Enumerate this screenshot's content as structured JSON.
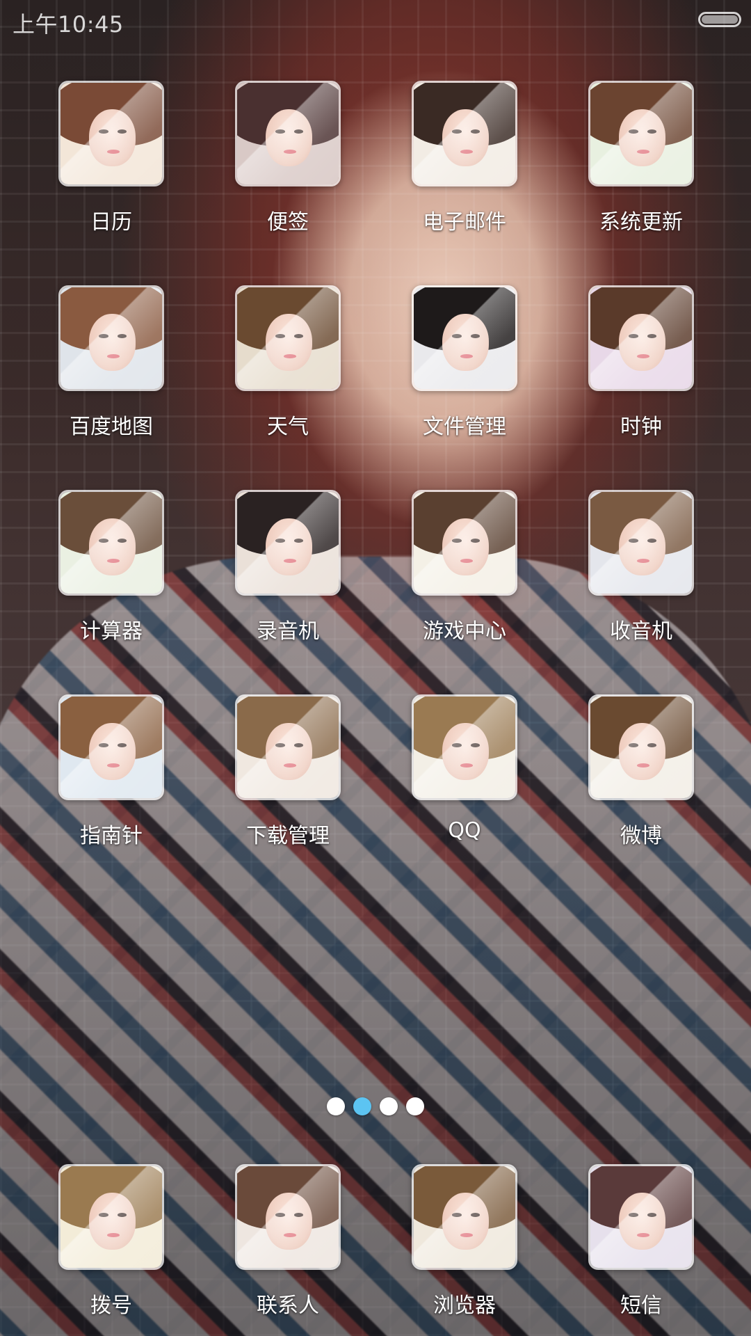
{
  "status_bar": {
    "time": "上午10:45",
    "battery_icon": "battery-icon"
  },
  "apps": [
    {
      "label": "日历",
      "icon": "calendar-icon"
    },
    {
      "label": "便签",
      "icon": "notes-icon"
    },
    {
      "label": "电子邮件",
      "icon": "email-icon"
    },
    {
      "label": "系统更新",
      "icon": "system-update-icon"
    },
    {
      "label": "百度地图",
      "icon": "baidu-map-icon"
    },
    {
      "label": "天气",
      "icon": "weather-icon"
    },
    {
      "label": "文件管理",
      "icon": "file-manager-icon"
    },
    {
      "label": "时钟",
      "icon": "clock-icon"
    },
    {
      "label": "计算器",
      "icon": "calculator-icon"
    },
    {
      "label": "录音机",
      "icon": "recorder-icon"
    },
    {
      "label": "游戏中心",
      "icon": "game-center-icon"
    },
    {
      "label": "收音机",
      "icon": "radio-icon"
    },
    {
      "label": "指南针",
      "icon": "compass-icon"
    },
    {
      "label": "下载管理",
      "icon": "download-manager-icon"
    },
    {
      "label": "QQ",
      "icon": "qq-icon"
    },
    {
      "label": "微博",
      "icon": "weibo-icon"
    }
  ],
  "page_indicator": {
    "total": 4,
    "active_index": 1,
    "active_color": "#5cc4f2",
    "inactive_color": "#ffffff"
  },
  "dock": [
    {
      "label": "拨号",
      "icon": "phone-icon"
    },
    {
      "label": "联系人",
      "icon": "contacts-icon"
    },
    {
      "label": "浏览器",
      "icon": "browser-icon"
    },
    {
      "label": "短信",
      "icon": "sms-icon"
    }
  ]
}
